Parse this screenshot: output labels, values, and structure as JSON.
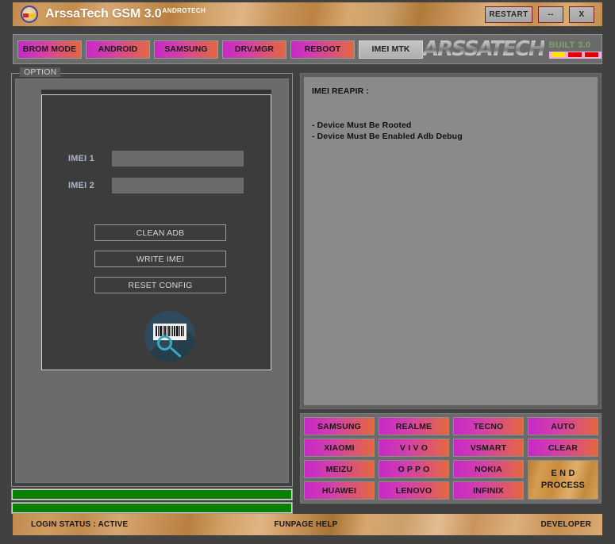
{
  "window": {
    "title": "ArssaTech GSM 3.0",
    "subtitle": "ANDROTECH",
    "logo_icon": "arssatech-badge-icon",
    "buttons": {
      "restart": "RESTART",
      "minimize": "--",
      "close": "X"
    }
  },
  "tabbar": {
    "tabs": [
      {
        "label": "BROM MODE",
        "active": false
      },
      {
        "label": "ANDROID",
        "active": false
      },
      {
        "label": "SAMSUNG",
        "active": false
      },
      {
        "label": "DRV.MGR",
        "active": false
      },
      {
        "label": "REBOOT",
        "active": false
      },
      {
        "label": "IMEI MTK",
        "active": true
      }
    ],
    "brand_word": "ARSSATECH",
    "built_label": "BUILT 3.0"
  },
  "option_group": {
    "legend": "OPTION",
    "fields": [
      {
        "label": "IMEI 1",
        "value": "",
        "placeholder": ""
      },
      {
        "label": "IMEI 2",
        "value": "",
        "placeholder": ""
      }
    ],
    "buttons": [
      "CLEAN ADB",
      "WRITE IMEI",
      "RESET CONFIG"
    ],
    "icon": "barcode-scan-icon"
  },
  "progress": {
    "bar1_percent": 100,
    "bar2_percent": 100,
    "color": "#0a8000"
  },
  "log": {
    "title": "IMEI REAPIR :",
    "lines": [
      "- Device Must Be Rooted",
      "- Device Must Be Enabled Adb Debug"
    ]
  },
  "brand_grid": {
    "buttons": [
      "SAMSUNG",
      "REALME",
      "TECNO",
      "AUTO",
      "XIAOMI",
      "V I V O",
      "VSMART",
      "CLEAR",
      "MEIZU",
      "O P P O",
      "NOKIA",
      "HUAWEI",
      "LENOVO",
      "INFINIX"
    ],
    "end_process": {
      "line1": "E N D",
      "line2": "PROCESS"
    }
  },
  "statusbar": {
    "login_status": "LOGIN STATUS :  ACTIVE",
    "help": "FUNPAGE HELP",
    "developer": "DEVELOPER"
  },
  "colors": {
    "accent_magenta": "#c629c6",
    "accent_orange": "#e4683f",
    "progress_green": "#0a8000",
    "gold": "#c9945b"
  }
}
